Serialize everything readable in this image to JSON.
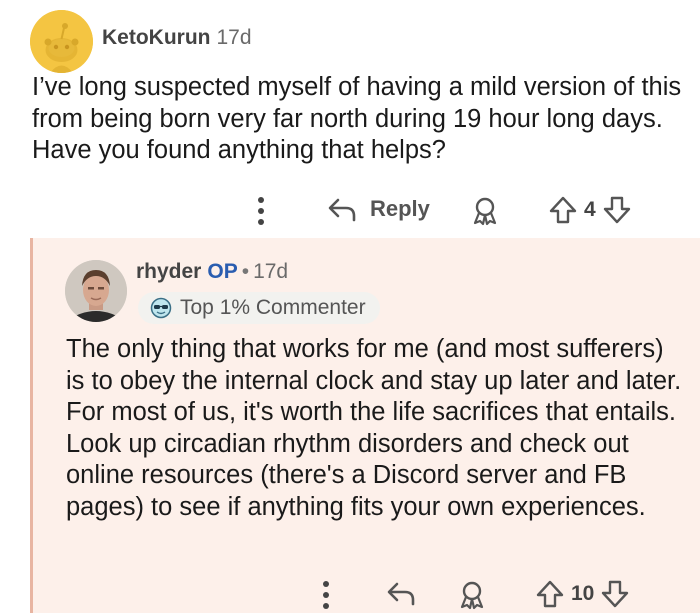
{
  "comment1": {
    "author": "KetoKurun",
    "age": "17d",
    "body": "I’ve long suspected myself of having a mild version of this from being born very far north during 19 hour long days. Have you found anything that helps?",
    "reply_label": "Reply",
    "vote_count": "4",
    "icons": [
      "more-vertical-icon",
      "reply-arrow-icon",
      "award-icon",
      "upvote-icon",
      "downvote-icon"
    ]
  },
  "comment2": {
    "author": "rhyder",
    "op_tag": "OP",
    "separator": "•",
    "age": "17d",
    "badge": "Top 1% Commenter",
    "body": "The only thing that works for me (and most sufferers) is to obey the internal clock and stay up later and later. For most of us, it's worth the life sacrifices that entails. Look up circadian rhythm disorders and check out online resources (there's a Discord server and FB pages) to see if anything fits your own experiences.",
    "vote_count": "10",
    "icons": [
      "more-vertical-icon",
      "reply-arrow-icon",
      "award-icon",
      "upvote-icon",
      "downvote-icon"
    ]
  },
  "colors": {
    "reply_bg": "#fdf0ea",
    "thread_line": "#e8b5a2",
    "op_blue": "#2a5db0",
    "avatar_yellow": "#f4c542"
  }
}
